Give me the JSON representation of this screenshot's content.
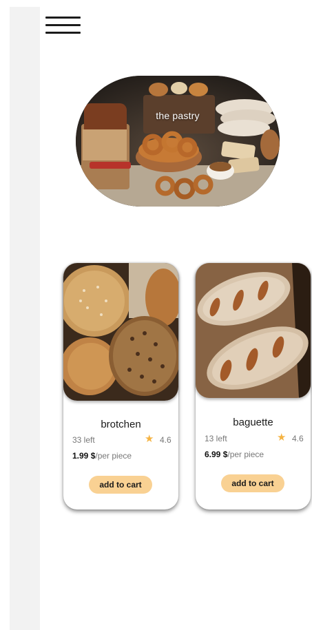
{
  "menu": {
    "icon": "hamburger-menu-icon"
  },
  "hero": {
    "title": "the pastry"
  },
  "products": [
    {
      "name": "brotchen",
      "stock": "33 left",
      "rating": "4.6",
      "price": "1.99 $",
      "unit": "/per piece",
      "button": "add to cart"
    },
    {
      "name": "baguette",
      "stock": "13 left",
      "rating": "4.6",
      "price": "6.99 $",
      "unit": "/per piece",
      "button": "add to cart"
    }
  ],
  "colors": {
    "accent": "#f9d193",
    "star": "#f5b342",
    "sidebar": "#f2f2f2"
  }
}
